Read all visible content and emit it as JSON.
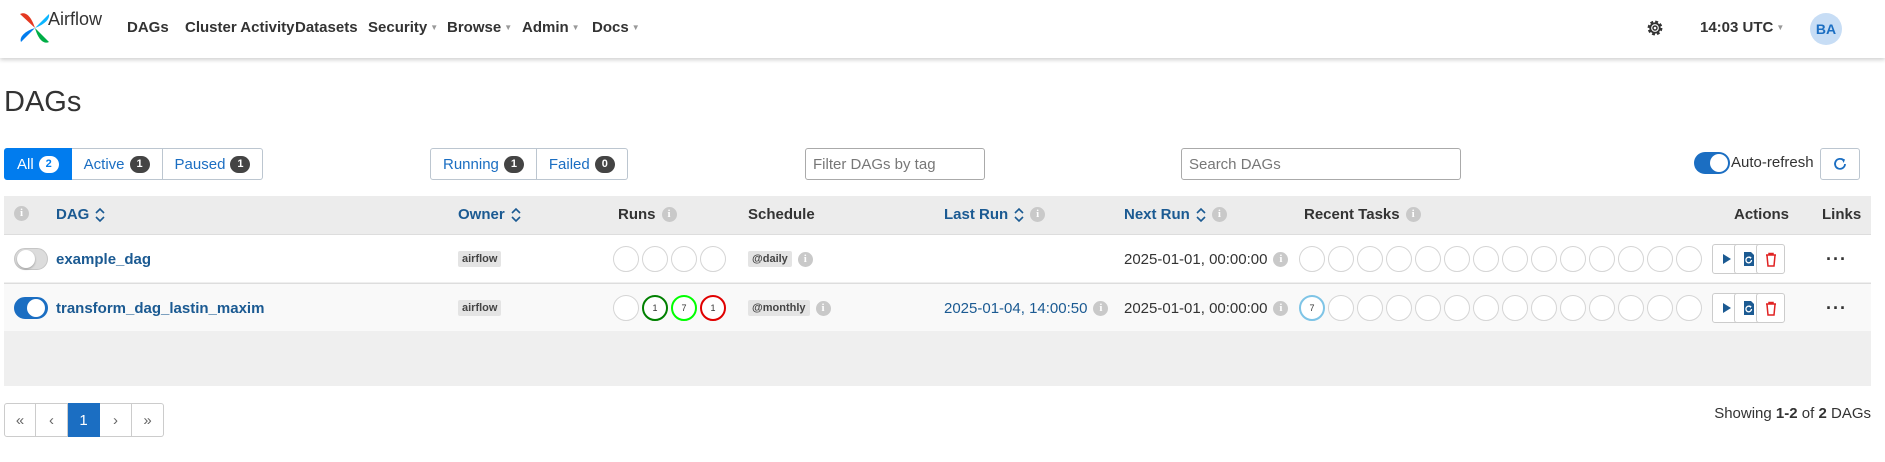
{
  "nav": {
    "brand": "Airflow",
    "items": [
      "DAGs",
      "Cluster Activity",
      "Datasets",
      "Security",
      "Browse",
      "Admin",
      "Docs"
    ],
    "time": "14:03 UTC",
    "avatar": "BA"
  },
  "page_title": "DAGs",
  "status_filters": [
    {
      "label": "All",
      "count": "2"
    },
    {
      "label": "Active",
      "count": "1"
    },
    {
      "label": "Paused",
      "count": "1"
    }
  ],
  "state_filters": [
    {
      "label": "Running",
      "count": "1"
    },
    {
      "label": "Failed",
      "count": "0"
    }
  ],
  "tag_filter_placeholder": "Filter DAGs by tag",
  "search_placeholder": "Search DAGs",
  "auto_refresh_label": "Auto-refresh",
  "auto_refresh_on": true,
  "columns": {
    "dag": "DAG",
    "owner": "Owner",
    "runs": "Runs",
    "schedule": "Schedule",
    "last_run": "Last Run",
    "next_run": "Next Run",
    "recent_tasks": "Recent Tasks",
    "actions": "Actions",
    "links": "Links"
  },
  "rows": [
    {
      "active": false,
      "dag_id": "example_dag",
      "owner": "airflow",
      "runs": [
        "",
        "",
        "",
        ""
      ],
      "schedule": "@daily",
      "last_run": "",
      "next_run": "2025-01-01, 00:00:00",
      "recent_tasks_first": ""
    },
    {
      "active": true,
      "dag_id": "transform_dag_lastin_maxim",
      "owner": "airflow",
      "runs": [
        "",
        "1",
        "7",
        "1"
      ],
      "schedule": "@monthly",
      "last_run": "2025-01-04, 14:00:50",
      "next_run": "2025-01-01, 00:00:00",
      "recent_tasks_first": "7"
    }
  ],
  "status_colors": {
    "success": "#008000",
    "running": "#00ff00",
    "failed": "#e00000",
    "queued": "#7ec4e6",
    "accent": "#017cee"
  },
  "pagination": [
    "«",
    "‹",
    "1",
    "›",
    "»"
  ],
  "showing": {
    "prefix": "Showing",
    "range": "1-2",
    "of": "of",
    "total": "2",
    "suffix": "DAGs"
  }
}
